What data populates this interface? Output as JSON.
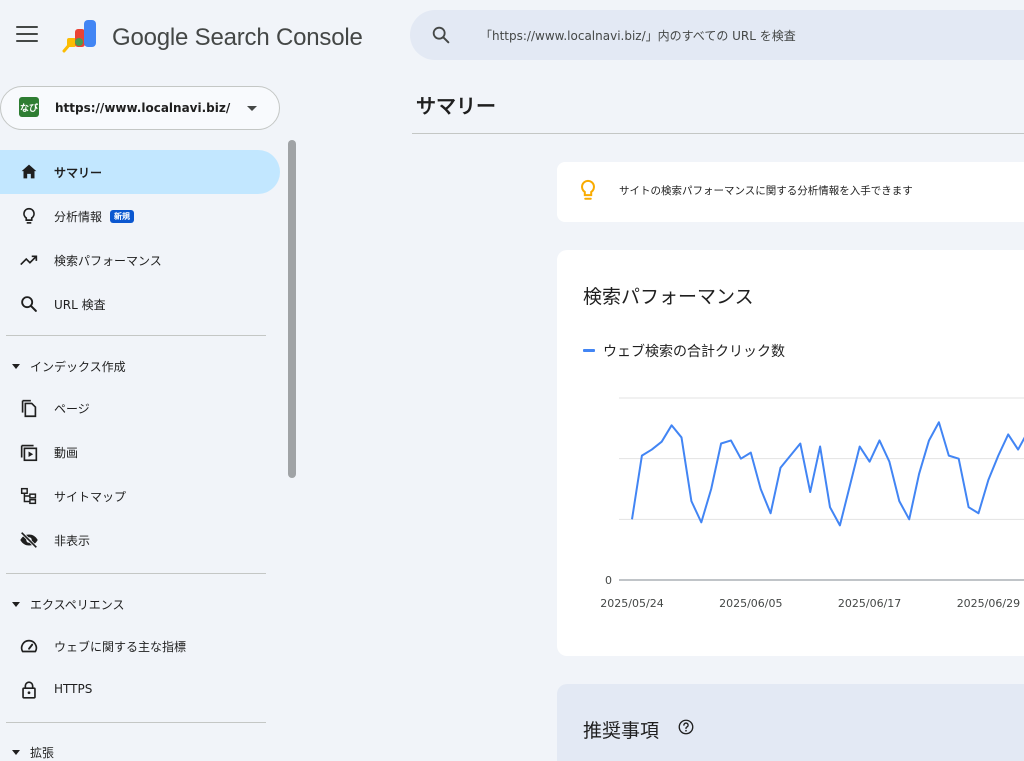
{
  "header": {
    "brand": "Google Search Console",
    "search_placeholder": "「https://www.localnavi.biz/」内のすべての URL を検査"
  },
  "property": {
    "icon_text": "なび",
    "url": "https://www.localnavi.biz/"
  },
  "sidebar": {
    "items": [
      {
        "label": "サマリー",
        "icon": "home-icon",
        "active": true
      },
      {
        "label": "分析情報",
        "icon": "lightbulb-icon",
        "badge": "新規"
      },
      {
        "label": "検索パフォーマンス",
        "icon": "trending-up-icon"
      },
      {
        "label": "URL 検査",
        "icon": "search-icon"
      }
    ],
    "sections": [
      {
        "label": "インデックス作成",
        "items": [
          {
            "label": "ページ",
            "icon": "pages-icon"
          },
          {
            "label": "動画",
            "icon": "video-icon"
          },
          {
            "label": "サイトマップ",
            "icon": "sitemap-icon"
          },
          {
            "label": "非表示",
            "icon": "visibility-off-icon"
          }
        ]
      },
      {
        "label": "エクスペリエンス",
        "items": [
          {
            "label": "ウェブに関する主な指標",
            "icon": "speed-gauge-icon"
          },
          {
            "label": "HTTPS",
            "icon": "lock-icon"
          }
        ]
      },
      {
        "label": "拡張",
        "items": []
      }
    ]
  },
  "main": {
    "page_title": "サマリー",
    "tip_text": "サイトの検索パフォーマンスに関する分析情報を入手できます",
    "performance_title": "検索パフォーマンス",
    "recommendations_title": "推奨事項"
  },
  "colors": {
    "accent": "#0b57d0",
    "active_nav": "#c2e7ff",
    "series": "#4285f4",
    "tip": "#f9ab00"
  },
  "chart_data": {
    "type": "line",
    "ylim": [
      0,
      3
    ],
    "y_ticks": [
      0
    ],
    "x_ticks": [
      "2025/05/24",
      "2025/06/05",
      "2025/06/17",
      "2025/06/29"
    ],
    "grid": true,
    "legend": "top-left",
    "series": [
      {
        "name": "ウェブ検索の合計クリック数",
        "values": [
          1.0,
          2.05,
          2.15,
          2.28,
          2.55,
          2.35,
          1.3,
          0.95,
          1.5,
          2.25,
          2.3,
          2.0,
          2.1,
          1.5,
          1.1,
          1.85,
          2.05,
          2.25,
          1.45,
          2.2,
          1.2,
          0.9,
          1.55,
          2.2,
          1.95,
          2.3,
          1.95,
          1.3,
          1.0,
          1.75,
          2.3,
          2.6,
          2.05,
          2.0,
          1.2,
          1.1,
          1.65,
          2.05,
          2.4,
          2.15,
          2.45
        ]
      }
    ]
  }
}
